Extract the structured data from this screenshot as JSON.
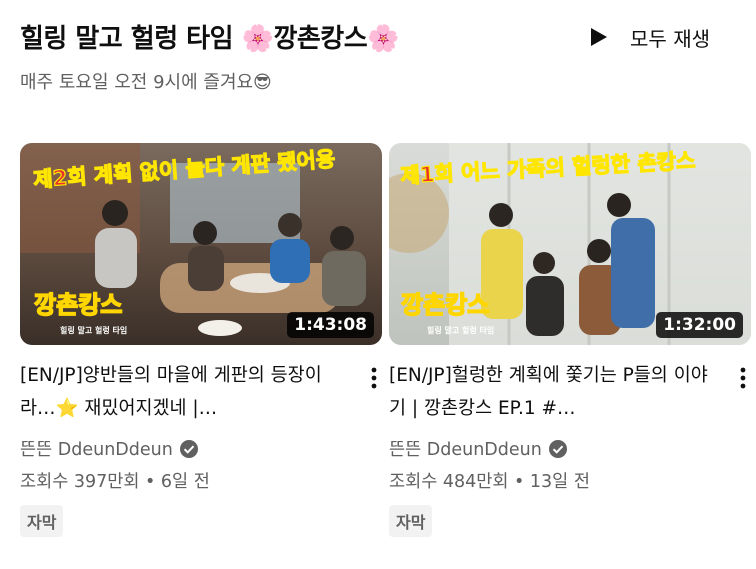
{
  "header": {
    "title": "힐링 말고 헐렁 타임 🌸깡촌캉스🌸",
    "subtitle": "매주 토요일 오전 9시에 즐겨요😎",
    "play_all_label": "모두 재생"
  },
  "videos": [
    {
      "title": "[EN/JP]양반들의 마을에 게판의 등장이라…⭐ 재밌어지겠네 |…",
      "duration": "1:43:08",
      "channel": "뜬뜬 DdeunDdeun",
      "meta": "조회수 397만회 • 6일 전",
      "badge": "자막",
      "thumb_caption": "제2회 계획 없이 놀다 게판 됐어용",
      "thumb_logo": "깡촌캉스",
      "thumb_logo_sub": "힐링 말고 헐렁 타임"
    },
    {
      "title": "[EN/JP]헐렁한 계획에 쫓기는 P들의 이야기 | 깡촌캉스 EP.1 #…",
      "duration": "1:32:00",
      "channel": "뜬뜬 DdeunDdeun",
      "meta": "조회수 484만회 • 13일 전",
      "badge": "자막",
      "thumb_caption": "제1회 어느 가족의 헐렁한 촌캉스",
      "thumb_logo": "깡촌캉스",
      "thumb_logo_sub": "힐링 말고 헐렁 타임"
    }
  ],
  "icons": {
    "play": "play-icon",
    "more": "more-vert-icon",
    "verified": "verified-check-icon"
  },
  "colors": {
    "caption_red": "#e8322b",
    "caption_yellow": "#ffe600",
    "text_secondary": "#606060"
  }
}
